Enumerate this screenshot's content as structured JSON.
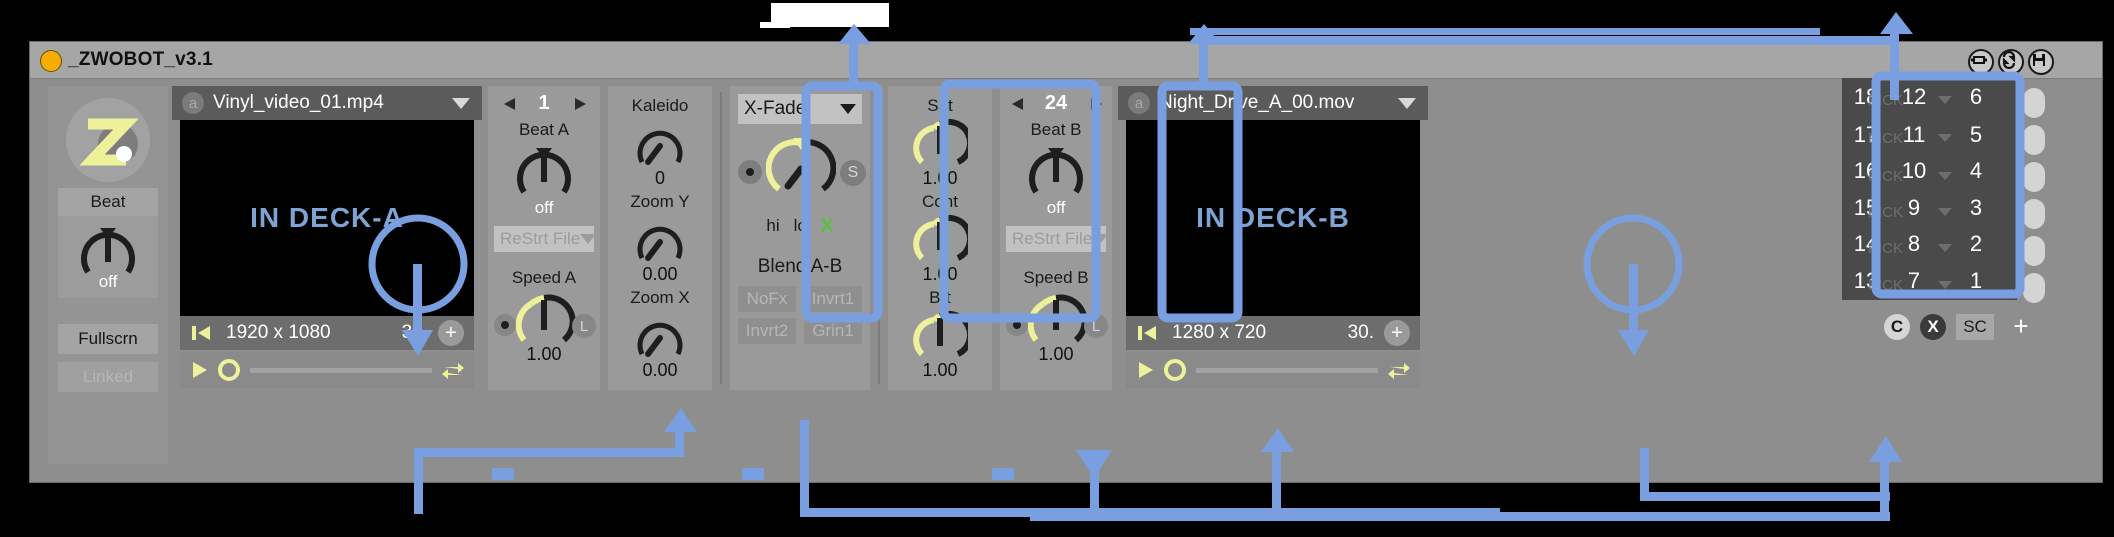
{
  "window": {
    "title": "_ZWOBOT_v3.1",
    "titlebar_icons": [
      "window-frame-icon",
      "refresh-swap-icon",
      "save-floppy-icon"
    ],
    "overlay_label_redacted": ""
  },
  "left_rail": {
    "logo": "Z",
    "beat_label": "Beat",
    "beat_value": "off",
    "fullscreen_button": "Fullscrn",
    "linked_button": "Linked"
  },
  "deck_a": {
    "source_badge": "a",
    "filename": "Vinyl_video_01.mp4",
    "screen_text": "IN DECK-A",
    "resolution": "1920 x 1080",
    "fps": "30.",
    "add_button": "+",
    "transport": {
      "play": "play-icon",
      "cue": "cue-icon",
      "loop": "loop-icon",
      "skip_start": "skip-to-start-icon"
    }
  },
  "deck_b": {
    "source_badge": "a",
    "filename": "Night_Drive_A_00.mov",
    "screen_text": "IN DECK-B",
    "resolution": "1280 x 720",
    "fps": "30.",
    "add_button": "+",
    "transport": {
      "play": "play-icon",
      "cue": "cue-icon",
      "loop": "loop-icon",
      "skip_start": "skip-to-start-icon"
    }
  },
  "beat_a": {
    "counter": "1",
    "prev": "left-arrow-icon",
    "next": "right-arrow-icon",
    "label": "Beat A",
    "value": "off",
    "mode_dropdown": "ReStrt File"
  },
  "beat_b": {
    "counter": "24",
    "prev": "left-arrow-icon",
    "next": "right-arrow-icon",
    "label": "Beat B",
    "value": "off",
    "mode_dropdown": "ReStrt File"
  },
  "speed_a": {
    "label": "Speed A",
    "value": "1.00",
    "link_button": "L"
  },
  "speed_b": {
    "label": "Speed B",
    "value": "1.00",
    "link_button": "L"
  },
  "fx_column": {
    "kaleido": {
      "label": "Kaleido",
      "value": "0"
    },
    "zoom_y": {
      "label": "Zoom Y",
      "value": "0.00"
    },
    "zoom_x": {
      "label": "Zoom X",
      "value": "0.00"
    }
  },
  "mix_column": {
    "mode_dropdown": "X-Fade",
    "mode_options": [
      "X-Fade"
    ],
    "curve_hi": "hi",
    "curve_lo": "lo",
    "curve_x": "X",
    "curve_x_color": "#56c23a",
    "solo_button": "S",
    "blend_label": "Blend A-B",
    "fx_buttons": [
      "NoFx",
      "Invrt1",
      "Invrt2",
      "Grin1"
    ]
  },
  "color_column": {
    "sat": {
      "label": "Sat",
      "value": "1.00"
    },
    "cont": {
      "label": "Cont",
      "value": "1.00"
    },
    "brt": {
      "label": "Brt",
      "value": "1.00"
    }
  },
  "pick_grid": {
    "rows": [
      [
        "18",
        "12",
        "6"
      ],
      [
        "17",
        "11",
        "5"
      ],
      [
        "16",
        "10",
        "4"
      ],
      [
        "15",
        "9",
        "3"
      ],
      [
        "14",
        "8",
        "2"
      ],
      [
        "13",
        "7",
        "1"
      ]
    ],
    "pick_label": "PICK",
    "pick_rows": 6
  },
  "bottom_bar": {
    "c_button": "C",
    "x_button": "X",
    "sc_button": "SC",
    "plus_button": "+"
  },
  "colors": {
    "accent_blue": "#7a9fe0",
    "knob_yellow": "#eef09a",
    "window_bg": "#8e8e8e",
    "titlebar_bg": "#a6a6a6",
    "screen_text": "#7fa3d4"
  }
}
